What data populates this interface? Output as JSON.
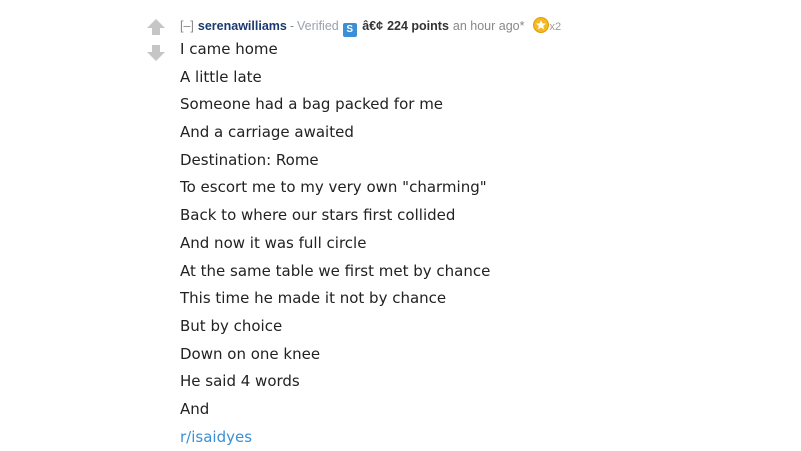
{
  "comment": {
    "collapse_label": "[–]",
    "author": "serenawilliams",
    "separator": "-",
    "flair_text": "Verified",
    "flair_badge": "S",
    "mojibake": "â€¢",
    "score": "224 points",
    "time": "an hour ago",
    "edited_marker": "*",
    "gild_count": "x2",
    "upvote_icon": "upvote-arrow-icon",
    "downvote_icon": "downvote-arrow-icon",
    "gild_icon": "gold-star-icon",
    "colors": {
      "author": "#1a3a6e",
      "link": "#3a8fd6",
      "flair_badge": "#3a8fd6",
      "gold": "#f5b921"
    },
    "lines": [
      "I came home",
      "A little late",
      "Someone had a bag packed for me",
      "And a carriage awaited",
      "Destination: Rome",
      "To escort me to my very own \"charming\"",
      "Back to where our stars first collided",
      "And now it was full circle",
      "At the same table we first met by chance",
      "This time he made it not by chance",
      "But by choice",
      "Down on one knee",
      "He said 4 words",
      "And"
    ],
    "link_text": "r/isaidyes"
  }
}
